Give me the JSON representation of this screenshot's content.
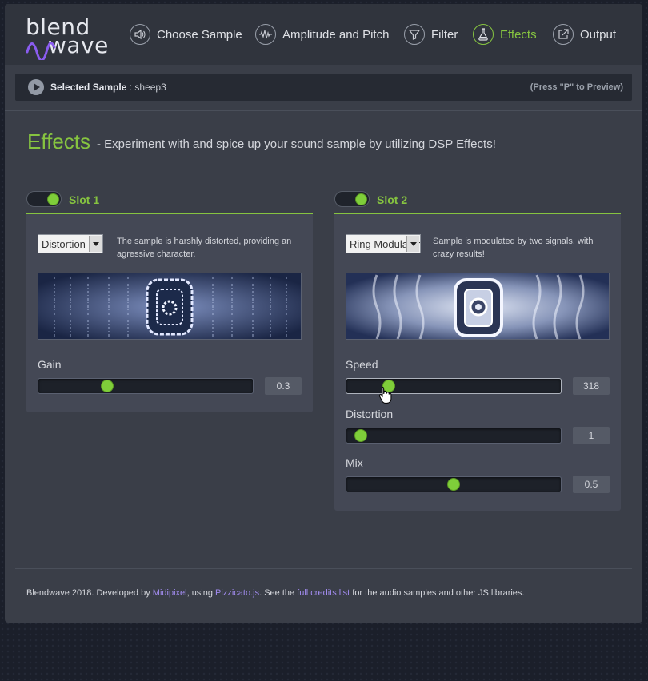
{
  "app": {
    "logo": {
      "line1": "blend",
      "line2": "wave"
    },
    "nav": [
      {
        "label": "Choose Sample",
        "icon": "speaker-icon"
      },
      {
        "label": "Amplitude and Pitch",
        "icon": "waveform-icon"
      },
      {
        "label": "Filter",
        "icon": "filter-icon"
      },
      {
        "label": "Effects",
        "icon": "flask-icon",
        "active": true
      },
      {
        "label": "Output",
        "icon": "export-icon"
      }
    ],
    "accent_color": "#86c440"
  },
  "sample_bar": {
    "label": "Selected Sample",
    "separator": " : ",
    "name": "sheep3",
    "hint": "(Press \"P\" to Preview)"
  },
  "page": {
    "title": "Effects",
    "subtitle": "- Experiment with and spice up your sound sample by utilizing DSP Effects!"
  },
  "slot1": {
    "title": "Slot 1",
    "enabled": true,
    "effect": "Distortion",
    "description": "The sample is harshly distorted, providing an agressive character.",
    "params": [
      {
        "label": "Gain",
        "value": "0.3",
        "fraction": 0.31
      }
    ]
  },
  "slot2": {
    "title": "Slot 2",
    "enabled": true,
    "effect": "Ring Modulator",
    "description": "Sample is modulated by two signals, with crazy results!",
    "params": [
      {
        "label": "Speed",
        "value": "318",
        "fraction": 0.18
      },
      {
        "label": "Distortion",
        "value": "1",
        "fraction": 0.04
      },
      {
        "label": "Mix",
        "value": "0.5",
        "fraction": 0.5
      }
    ]
  },
  "footer": {
    "t1": "Blendwave 2018. Developed by ",
    "link1": "Midipixel",
    "t2": ", using ",
    "link2": "Pizzicato.js",
    "t3": ". See the ",
    "link3": "full credits list",
    "t4": " for the audio samples and other JS libraries."
  }
}
